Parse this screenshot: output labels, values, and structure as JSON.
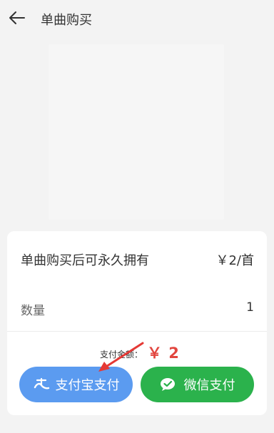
{
  "header": {
    "title": "单曲购买"
  },
  "purchase": {
    "description": "单曲购买后可永久拥有",
    "price": "￥2/首",
    "quantity_label": "数量",
    "quantity_value": "1"
  },
  "payment": {
    "amount_label": "支付金额：",
    "amount_value": "￥ 2",
    "alipay_label": "支付宝支付",
    "wechat_label": "微信支付"
  },
  "colors": {
    "alipay": "#5b9bf0",
    "wechat": "#2bb24c",
    "amount": "#e2463f",
    "annotation_arrow": "#e53935"
  },
  "icons": {
    "back": "arrow-left-icon",
    "alipay": "alipay-icon",
    "wechat": "wechat-icon"
  }
}
